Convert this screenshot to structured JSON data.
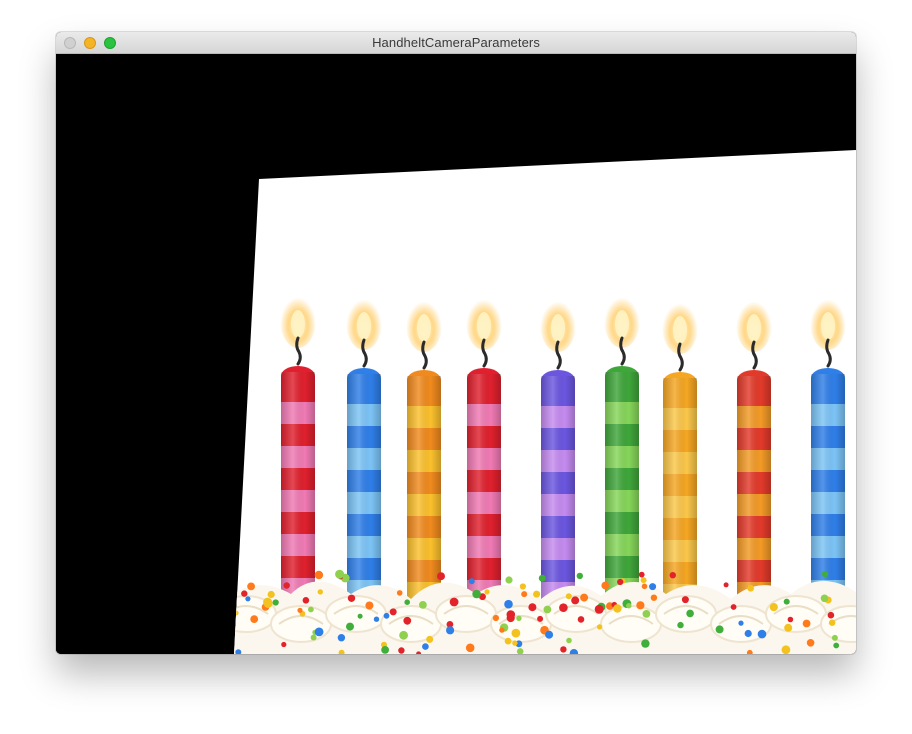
{
  "window": {
    "title": "HandheltCameraParameters",
    "controls": {
      "close": {
        "icon": "close-dot-icon",
        "color": "#d0d0d0"
      },
      "minimize": {
        "icon": "minimize-dot-icon",
        "color": "#f5b426"
      },
      "zoom": {
        "icon": "zoom-dot-icon",
        "color": "#2ac33f"
      }
    }
  },
  "viewport": {
    "background": "#000000",
    "image": {
      "subject": "birthday-candles-on-cake",
      "candles": [
        {
          "colors": [
            "#e0202e",
            "#f07ab4"
          ]
        },
        {
          "colors": [
            "#2f7fe8",
            "#7cc4f6"
          ]
        },
        {
          "colors": [
            "#f08a1e",
            "#fbc02d"
          ]
        },
        {
          "colors": [
            "#e0202e",
            "#f07ab4"
          ]
        },
        {
          "colors": [
            "#6b56e0",
            "#c58bf0"
          ]
        },
        {
          "colors": [
            "#3fa63a",
            "#86d65a"
          ]
        },
        {
          "colors": [
            "#f5a623",
            "#fbc74a"
          ]
        },
        {
          "colors": [
            "#e23a2a",
            "#f29a26"
          ]
        },
        {
          "colors": [
            "#2f7fe8",
            "#7cc4f6"
          ]
        }
      ]
    }
  }
}
